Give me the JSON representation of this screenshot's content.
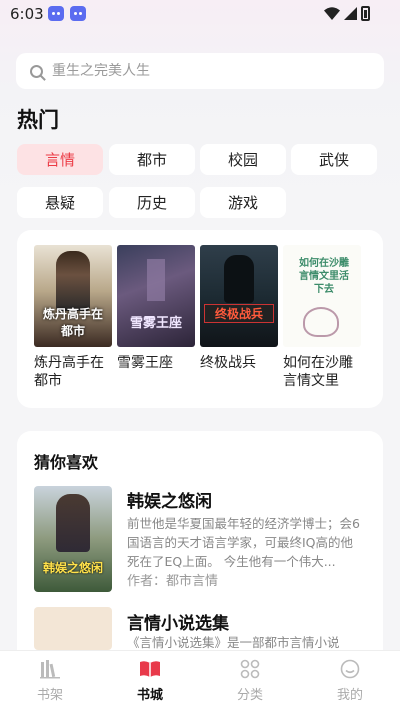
{
  "status": {
    "time": "6:03"
  },
  "search": {
    "placeholder": "重生之完美人生"
  },
  "hot": {
    "title": "热门",
    "tags": [
      "言情",
      "都市",
      "校园",
      "武侠",
      "悬疑",
      "历史",
      "游戏"
    ],
    "books": [
      {
        "title": "炼丹高手在都市",
        "cover_text": "炼丹高手在都市"
      },
      {
        "title": "雪雾王座",
        "cover_text": "雪雾王座"
      },
      {
        "title": "终极战兵",
        "cover_text": "终极战兵"
      },
      {
        "title": "如何在沙雕言情文里",
        "cover_text": "如何在沙雕言情文里活下去"
      }
    ]
  },
  "recommend": {
    "title": "猜你喜欢",
    "items": [
      {
        "name": "韩娱之悠闲",
        "desc": "前世他是华夏国最年轻的经济学博士；会6国语言的天才语言学家，可最终IQ高的他死在了EQ上面。 今生他有一个伟大...",
        "author": "作者：都市言情",
        "cover_text": "韩娱之悠闲"
      },
      {
        "name": "言情小说选集",
        "desc": "《言情小说选集》是一部都市言情小说"
      }
    ]
  },
  "tabbar": {
    "tabs": [
      {
        "label": "书架",
        "icon": "bookshelf-icon"
      },
      {
        "label": "书城",
        "icon": "book-open-icon"
      },
      {
        "label": "分类",
        "icon": "category-icon"
      },
      {
        "label": "我的",
        "icon": "profile-icon"
      }
    ]
  }
}
